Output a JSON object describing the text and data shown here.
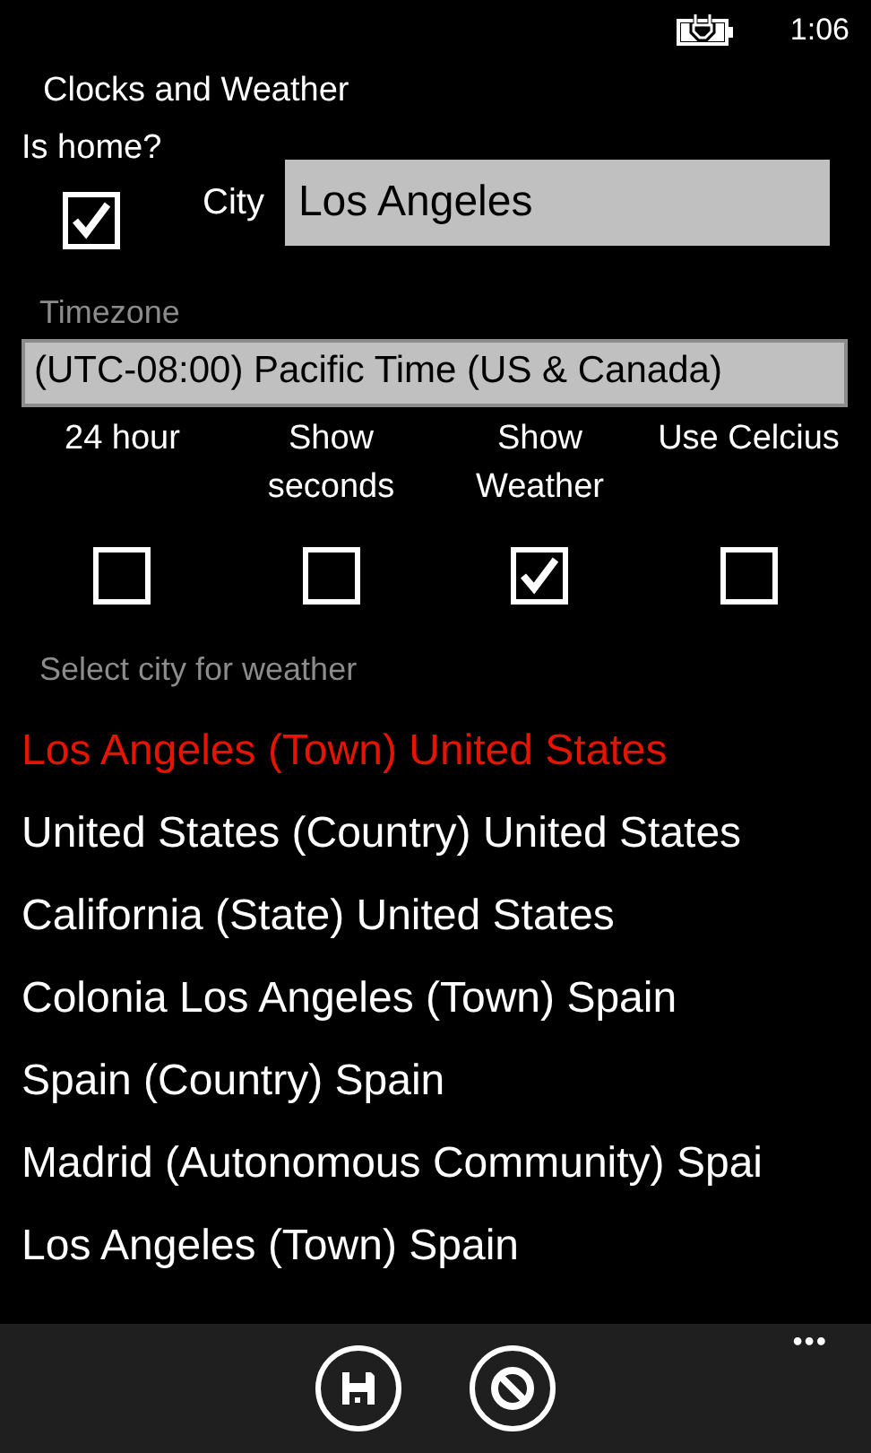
{
  "status_bar": {
    "time": "1:06"
  },
  "title": "Clocks and Weather",
  "is_home": {
    "label": "Is home?",
    "checked": true
  },
  "city": {
    "label": "City",
    "value": "Los Angeles"
  },
  "timezone": {
    "label": "Timezone",
    "value": "(UTC-08:00) Pacific Time (US & Canada)"
  },
  "options": [
    {
      "label": "24 hour",
      "checked": false
    },
    {
      "label": "Show seconds",
      "checked": false
    },
    {
      "label": "Show Weather",
      "checked": true
    },
    {
      "label": "Use Celcius",
      "checked": false
    }
  ],
  "weather_city": {
    "label": "Select city for weather",
    "items": [
      {
        "name": "Los Angeles (Town)",
        "country": "United States",
        "selected": true
      },
      {
        "name": "United States (Country)",
        "country": "United States",
        "selected": false
      },
      {
        "name": "California (State)",
        "country": "United States",
        "selected": false
      },
      {
        "name": "Colonia Los Angeles (Town)",
        "country": "Spain",
        "selected": false
      },
      {
        "name": "Spain (Country)",
        "country": "Spain",
        "selected": false
      },
      {
        "name": "Madrid (Autonomous Community)",
        "country": "Spai",
        "selected": false
      },
      {
        "name": "Los Angeles (Town)",
        "country": "Spain",
        "selected": false
      }
    ]
  },
  "app_bar": {
    "more": "•••"
  }
}
